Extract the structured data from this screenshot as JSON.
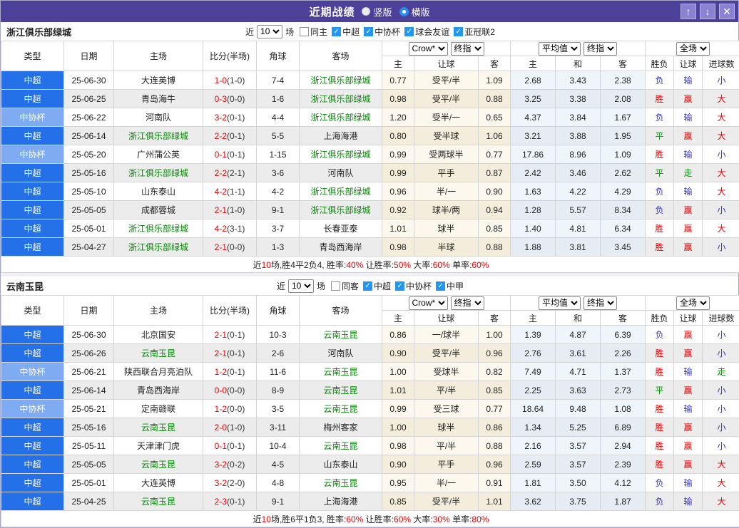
{
  "titlebar": {
    "title": "近期战绩",
    "vertical_label": "竖版",
    "horizontal_label": "横版",
    "up_glyph": "↑",
    "down_glyph": "↓",
    "close_glyph": "✕"
  },
  "filter_common": {
    "prefix": "近",
    "suffix": "场"
  },
  "table_columns": {
    "type": "类型",
    "date": "日期",
    "home": "主场",
    "score": "比分(半场)",
    "corner": "角球",
    "away": "客场",
    "asian_group": {
      "select1": "Crow*",
      "select2": "终指",
      "cols": [
        "主",
        "让球",
        "客"
      ]
    },
    "euro_group": {
      "select1": "平均值",
      "select2": "终指",
      "cols": [
        "主",
        "和",
        "客"
      ]
    },
    "result_group": {
      "select": "全场",
      "cols": [
        "胜负",
        "让球",
        "进球数"
      ]
    }
  },
  "colors": {
    "accent_purple": "#4c4099",
    "league_blue": "#2470e8",
    "cup_blue": "#7fabf3",
    "win_red": "#e60000",
    "lose_blue": "#3333cc",
    "draw_green": "#009900",
    "focus_team_green": "#008800",
    "checkbox_blue": "#2196f3",
    "asian_bg": "#fdf8ed",
    "euro_bg": "#eef5fb"
  },
  "teams": [
    {
      "name": "浙江俱乐部绿城",
      "match_count": "10",
      "filters": [
        {
          "label": "同主",
          "checked": false
        },
        {
          "label": "中超",
          "checked": true
        },
        {
          "label": "中协杯",
          "checked": true
        },
        {
          "label": "球会友谊",
          "checked": true
        },
        {
          "label": "亚冠联2",
          "checked": true
        }
      ],
      "rows": [
        {
          "type": "中超",
          "type_class": "super",
          "date": "25-06-30",
          "home": "大连英博",
          "home_focus": false,
          "score": "1-0",
          "half": "(1-0)",
          "corner": "7-4",
          "away": "浙江俱乐部绿城",
          "away_focus": true,
          "asian": [
            "0.77",
            "受平/半",
            "1.09"
          ],
          "euro": [
            "2.68",
            "3.43",
            "2.38"
          ],
          "result": [
            {
              "t": "负",
              "c": "lose"
            },
            {
              "t": "输",
              "c": "lose"
            },
            {
              "t": "小",
              "c": "lose"
            }
          ]
        },
        {
          "type": "中超",
          "type_class": "super",
          "date": "25-06-25",
          "home": "青岛海牛",
          "home_focus": false,
          "score": "0-3",
          "half": "(0-0)",
          "corner": "1-6",
          "away": "浙江俱乐部绿城",
          "away_focus": true,
          "asian": [
            "0.98",
            "受平/半",
            "0.88"
          ],
          "euro": [
            "3.25",
            "3.38",
            "2.08"
          ],
          "result": [
            {
              "t": "胜",
              "c": "win"
            },
            {
              "t": "赢",
              "c": "win"
            },
            {
              "t": "大",
              "c": "win"
            }
          ]
        },
        {
          "type": "中协杯",
          "type_class": "cup",
          "date": "25-06-22",
          "home": "河南队",
          "home_focus": false,
          "score": "3-2",
          "half": "(0-1)",
          "corner": "4-4",
          "away": "浙江俱乐部绿城",
          "away_focus": true,
          "asian": [
            "1.20",
            "受半/一",
            "0.65"
          ],
          "euro": [
            "4.37",
            "3.84",
            "1.67"
          ],
          "result": [
            {
              "t": "负",
              "c": "lose"
            },
            {
              "t": "输",
              "c": "lose"
            },
            {
              "t": "大",
              "c": "win"
            }
          ]
        },
        {
          "type": "中超",
          "type_class": "super",
          "date": "25-06-14",
          "home": "浙江俱乐部绿城",
          "home_focus": true,
          "score": "2-2",
          "half": "(0-1)",
          "corner": "5-5",
          "away": "上海海港",
          "away_focus": false,
          "asian": [
            "0.80",
            "受半球",
            "1.06"
          ],
          "euro": [
            "3.21",
            "3.88",
            "1.95"
          ],
          "result": [
            {
              "t": "平",
              "c": "draw"
            },
            {
              "t": "赢",
              "c": "win"
            },
            {
              "t": "大",
              "c": "win"
            }
          ]
        },
        {
          "type": "中协杯",
          "type_class": "cup",
          "date": "25-05-20",
          "home": "广州蒲公英",
          "home_focus": false,
          "score": "0-1",
          "half": "(0-1)",
          "corner": "1-15",
          "away": "浙江俱乐部绿城",
          "away_focus": true,
          "asian": [
            "0.99",
            "受两球半",
            "0.77"
          ],
          "euro": [
            "17.86",
            "8.96",
            "1.09"
          ],
          "result": [
            {
              "t": "胜",
              "c": "win"
            },
            {
              "t": "输",
              "c": "lose"
            },
            {
              "t": "小",
              "c": "lose"
            }
          ]
        },
        {
          "type": "中超",
          "type_class": "super",
          "date": "25-05-16",
          "home": "浙江俱乐部绿城",
          "home_focus": true,
          "score": "2-2",
          "half": "(2-1)",
          "corner": "3-6",
          "away": "河南队",
          "away_focus": false,
          "asian": [
            "0.99",
            "平手",
            "0.87"
          ],
          "euro": [
            "2.42",
            "3.46",
            "2.62"
          ],
          "result": [
            {
              "t": "平",
              "c": "draw"
            },
            {
              "t": "走",
              "c": "draw"
            },
            {
              "t": "大",
              "c": "win"
            }
          ]
        },
        {
          "type": "中超",
          "type_class": "super",
          "date": "25-05-10",
          "home": "山东泰山",
          "home_focus": false,
          "score": "4-2",
          "half": "(1-1)",
          "corner": "4-2",
          "away": "浙江俱乐部绿城",
          "away_focus": true,
          "asian": [
            "0.96",
            "半/一",
            "0.90"
          ],
          "euro": [
            "1.63",
            "4.22",
            "4.29"
          ],
          "result": [
            {
              "t": "负",
              "c": "lose"
            },
            {
              "t": "输",
              "c": "lose"
            },
            {
              "t": "大",
              "c": "win"
            }
          ]
        },
        {
          "type": "中超",
          "type_class": "super",
          "date": "25-05-05",
          "home": "成都蓉城",
          "home_focus": false,
          "score": "2-1",
          "half": "(1-0)",
          "corner": "9-1",
          "away": "浙江俱乐部绿城",
          "away_focus": true,
          "asian": [
            "0.92",
            "球半/两",
            "0.94"
          ],
          "euro": [
            "1.28",
            "5.57",
            "8.34"
          ],
          "result": [
            {
              "t": "负",
              "c": "lose"
            },
            {
              "t": "赢",
              "c": "win"
            },
            {
              "t": "小",
              "c": "lose"
            }
          ]
        },
        {
          "type": "中超",
          "type_class": "super",
          "date": "25-05-01",
          "home": "浙江俱乐部绿城",
          "home_focus": true,
          "score": "4-2",
          "half": "(3-1)",
          "corner": "3-7",
          "away": "长春亚泰",
          "away_focus": false,
          "asian": [
            "1.01",
            "球半",
            "0.85"
          ],
          "euro": [
            "1.40",
            "4.81",
            "6.34"
          ],
          "result": [
            {
              "t": "胜",
              "c": "win"
            },
            {
              "t": "赢",
              "c": "win"
            },
            {
              "t": "大",
              "c": "win"
            }
          ]
        },
        {
          "type": "中超",
          "type_class": "super",
          "date": "25-04-27",
          "home": "浙江俱乐部绿城",
          "home_focus": true,
          "score": "2-1",
          "half": "(0-0)",
          "corner": "1-3",
          "away": "青岛西海岸",
          "away_focus": false,
          "asian": [
            "0.98",
            "半球",
            "0.88"
          ],
          "euro": [
            "1.88",
            "3.81",
            "3.45"
          ],
          "result": [
            {
              "t": "胜",
              "c": "win"
            },
            {
              "t": "赢",
              "c": "win"
            },
            {
              "t": "小",
              "c": "lose"
            }
          ]
        }
      ],
      "summary": [
        {
          "t": "近"
        },
        {
          "t": "10",
          "red": true
        },
        {
          "t": "场,胜4平2负4, 胜率:"
        },
        {
          "t": "40%",
          "red": true
        },
        {
          "t": " 让胜率:"
        },
        {
          "t": "50%",
          "red": true
        },
        {
          "t": " 大率:"
        },
        {
          "t": "60%",
          "red": true
        },
        {
          "t": " 单率:"
        },
        {
          "t": "60%",
          "red": true
        }
      ]
    },
    {
      "name": "云南玉昆",
      "match_count": "10",
      "filters": [
        {
          "label": "同客",
          "checked": false
        },
        {
          "label": "中超",
          "checked": true
        },
        {
          "label": "中协杯",
          "checked": true
        },
        {
          "label": "中甲",
          "checked": true
        }
      ],
      "rows": [
        {
          "type": "中超",
          "type_class": "super",
          "date": "25-06-30",
          "home": "北京国安",
          "home_focus": false,
          "score": "2-1",
          "half": "(0-1)",
          "corner": "10-3",
          "away": "云南玉昆",
          "away_focus": true,
          "asian": [
            "0.86",
            "一/球半",
            "1.00"
          ],
          "euro": [
            "1.39",
            "4.87",
            "6.39"
          ],
          "result": [
            {
              "t": "负",
              "c": "lose"
            },
            {
              "t": "赢",
              "c": "win"
            },
            {
              "t": "小",
              "c": "lose"
            }
          ]
        },
        {
          "type": "中超",
          "type_class": "super",
          "date": "25-06-26",
          "home": "云南玉昆",
          "home_focus": true,
          "score": "2-1",
          "half": "(0-1)",
          "corner": "2-6",
          "away": "河南队",
          "away_focus": false,
          "asian": [
            "0.90",
            "受平/半",
            "0.96"
          ],
          "euro": [
            "2.76",
            "3.61",
            "2.26"
          ],
          "result": [
            {
              "t": "胜",
              "c": "win"
            },
            {
              "t": "赢",
              "c": "win"
            },
            {
              "t": "小",
              "c": "lose"
            }
          ]
        },
        {
          "type": "中协杯",
          "type_class": "cup",
          "date": "25-06-21",
          "home": "陕西联合月亮泊队",
          "home_focus": false,
          "score": "1-2",
          "half": "(0-1)",
          "corner": "11-6",
          "away": "云南玉昆",
          "away_focus": true,
          "asian": [
            "1.00",
            "受球半",
            "0.82"
          ],
          "euro": [
            "7.49",
            "4.71",
            "1.37"
          ],
          "result": [
            {
              "t": "胜",
              "c": "win"
            },
            {
              "t": "输",
              "c": "lose"
            },
            {
              "t": "走",
              "c": "draw"
            }
          ]
        },
        {
          "type": "中超",
          "type_class": "super",
          "date": "25-06-14",
          "home": "青岛西海岸",
          "home_focus": false,
          "score": "0-0",
          "half": "(0-0)",
          "corner": "8-9",
          "away": "云南玉昆",
          "away_focus": true,
          "asian": [
            "1.01",
            "平/半",
            "0.85"
          ],
          "euro": [
            "2.25",
            "3.63",
            "2.73"
          ],
          "result": [
            {
              "t": "平",
              "c": "draw"
            },
            {
              "t": "赢",
              "c": "win"
            },
            {
              "t": "小",
              "c": "lose"
            }
          ]
        },
        {
          "type": "中协杯",
          "type_class": "cup",
          "date": "25-05-21",
          "home": "定南赣联",
          "home_focus": false,
          "score": "1-2",
          "half": "(0-0)",
          "corner": "3-5",
          "away": "云南玉昆",
          "away_focus": true,
          "asian": [
            "0.99",
            "受三球",
            "0.77"
          ],
          "euro": [
            "18.64",
            "9.48",
            "1.08"
          ],
          "result": [
            {
              "t": "胜",
              "c": "win"
            },
            {
              "t": "输",
              "c": "lose"
            },
            {
              "t": "小",
              "c": "lose"
            }
          ]
        },
        {
          "type": "中超",
          "type_class": "super",
          "date": "25-05-16",
          "home": "云南玉昆",
          "home_focus": true,
          "score": "2-0",
          "half": "(1-0)",
          "corner": "3-11",
          "away": "梅州客家",
          "away_focus": false,
          "asian": [
            "1.00",
            "球半",
            "0.86"
          ],
          "euro": [
            "1.34",
            "5.25",
            "6.89"
          ],
          "result": [
            {
              "t": "胜",
              "c": "win"
            },
            {
              "t": "赢",
              "c": "win"
            },
            {
              "t": "小",
              "c": "lose"
            }
          ]
        },
        {
          "type": "中超",
          "type_class": "super",
          "date": "25-05-11",
          "home": "天津津门虎",
          "home_focus": false,
          "score": "0-1",
          "half": "(0-1)",
          "corner": "10-4",
          "away": "云南玉昆",
          "away_focus": true,
          "asian": [
            "0.98",
            "平/半",
            "0.88"
          ],
          "euro": [
            "2.16",
            "3.57",
            "2.94"
          ],
          "result": [
            {
              "t": "胜",
              "c": "win"
            },
            {
              "t": "赢",
              "c": "win"
            },
            {
              "t": "小",
              "c": "lose"
            }
          ]
        },
        {
          "type": "中超",
          "type_class": "super",
          "date": "25-05-05",
          "home": "云南玉昆",
          "home_focus": true,
          "score": "3-2",
          "half": "(0-2)",
          "corner": "4-5",
          "away": "山东泰山",
          "away_focus": false,
          "asian": [
            "0.90",
            "平手",
            "0.96"
          ],
          "euro": [
            "2.59",
            "3.57",
            "2.39"
          ],
          "result": [
            {
              "t": "胜",
              "c": "win"
            },
            {
              "t": "赢",
              "c": "win"
            },
            {
              "t": "大",
              "c": "win"
            }
          ]
        },
        {
          "type": "中超",
          "type_class": "super",
          "date": "25-05-01",
          "home": "大连英博",
          "home_focus": false,
          "score": "3-2",
          "half": "(2-0)",
          "corner": "4-8",
          "away": "云南玉昆",
          "away_focus": true,
          "asian": [
            "0.95",
            "半/一",
            "0.91"
          ],
          "euro": [
            "1.81",
            "3.50",
            "4.12"
          ],
          "result": [
            {
              "t": "负",
              "c": "lose"
            },
            {
              "t": "输",
              "c": "lose"
            },
            {
              "t": "大",
              "c": "win"
            }
          ]
        },
        {
          "type": "中超",
          "type_class": "super",
          "date": "25-04-25",
          "home": "云南玉昆",
          "home_focus": true,
          "score": "2-3",
          "half": "(0-1)",
          "corner": "9-1",
          "away": "上海海港",
          "away_focus": false,
          "asian": [
            "0.85",
            "受平/半",
            "1.01"
          ],
          "euro": [
            "3.62",
            "3.75",
            "1.87"
          ],
          "result": [
            {
              "t": "负",
              "c": "lose"
            },
            {
              "t": "输",
              "c": "lose"
            },
            {
              "t": "大",
              "c": "win"
            }
          ]
        }
      ],
      "summary": [
        {
          "t": "近"
        },
        {
          "t": "10",
          "red": true
        },
        {
          "t": "场,胜6平1负3, 胜率:"
        },
        {
          "t": "60%",
          "red": true
        },
        {
          "t": " 让胜率:"
        },
        {
          "t": "60%",
          "red": true
        },
        {
          "t": " 大率:"
        },
        {
          "t": "30%",
          "red": true
        },
        {
          "t": " 单率:"
        },
        {
          "t": "80%",
          "red": true
        }
      ]
    }
  ]
}
